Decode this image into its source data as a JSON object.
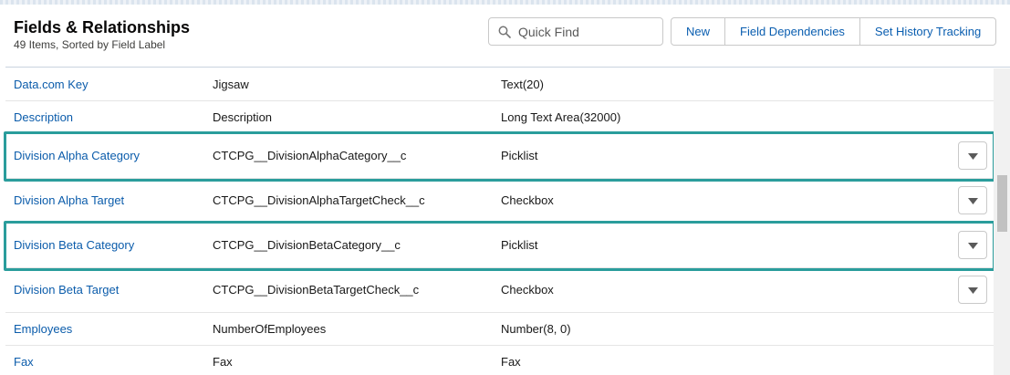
{
  "header": {
    "title": "Fields & Relationships",
    "subtitle": "49 Items, Sorted by Field Label"
  },
  "search": {
    "placeholder": "Quick Find"
  },
  "buttons": {
    "new": "New",
    "field_dependencies": "Field Dependencies",
    "history_tracking": "Set History Tracking"
  },
  "rows": [
    {
      "label": "Data.com Key",
      "api_name": "Jigsaw",
      "type": "Text(20)",
      "has_menu": false
    },
    {
      "label": "Description",
      "api_name": "Description",
      "type": "Long Text Area(32000)",
      "has_menu": false
    },
    {
      "label": "Division Alpha Category",
      "api_name": "CTCPG__DivisionAlphaCategory__c",
      "type": "Picklist",
      "has_menu": true
    },
    {
      "label": "Division Alpha Target",
      "api_name": "CTCPG__DivisionAlphaTargetCheck__c",
      "type": "Checkbox",
      "has_menu": true
    },
    {
      "label": "Division Beta Category",
      "api_name": "CTCPG__DivisionBetaCategory__c",
      "type": "Picklist",
      "has_menu": true
    },
    {
      "label": "Division Beta Target",
      "api_name": "CTCPG__DivisionBetaTargetCheck__c",
      "type": "Checkbox",
      "has_menu": true
    },
    {
      "label": "Employees",
      "api_name": "NumberOfEmployees",
      "type": "Number(8, 0)",
      "has_menu": false
    },
    {
      "label": "Fax",
      "api_name": "Fax",
      "type": "Fax",
      "has_menu": false
    }
  ],
  "colors": {
    "link": "#0b5cab",
    "highlight": "#2a9d9c"
  },
  "icons": {
    "search": "search-icon",
    "row_menu": "chevron-down-icon"
  }
}
